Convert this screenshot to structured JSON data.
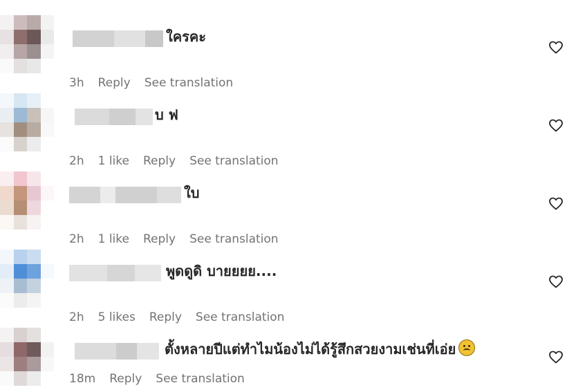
{
  "comments": [
    {
      "text": "ใครคะ",
      "time": "3h",
      "likes": "",
      "reply_label": "Reply",
      "translate_label": "See translation",
      "emoji": ""
    },
    {
      "text": "บ ฟ",
      "time": "2h",
      "likes": "1 like",
      "reply_label": "Reply",
      "translate_label": "See translation",
      "emoji": ""
    },
    {
      "text": "ใบ",
      "time": "2h",
      "likes": "1 like",
      "reply_label": "Reply",
      "translate_label": "See translation",
      "emoji": ""
    },
    {
      "text": "พูดดูดิ บายยยย....",
      "time": "2h",
      "likes": "5 likes",
      "reply_label": "Reply",
      "translate_label": "See translation",
      "emoji": ""
    },
    {
      "text": "ตั้งหลายปีแต่ทำไมน้องไม่ได้รู้สึกสวยงามเช่นที่เอ่ย",
      "time": "18m",
      "likes": "",
      "reply_label": "Reply",
      "translate_label": "See translation",
      "emoji": "frowning-face"
    }
  ],
  "icons": {
    "like": "heart-outline-icon"
  },
  "colors": {
    "text": "#262626",
    "meta": "#737373",
    "background": "#ffffff"
  }
}
